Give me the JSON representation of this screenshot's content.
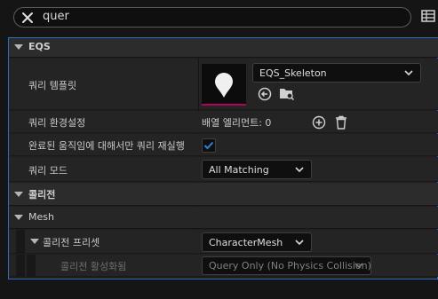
{
  "search": {
    "value": "quer"
  },
  "sections": {
    "eqs": "EQS",
    "collision": "콜리전",
    "mesh": "Mesh"
  },
  "rows": {
    "query_template": {
      "label": "쿼리 템플릿",
      "value": "EQS_Skeleton"
    },
    "query_config": {
      "label": "쿼리 환경설정",
      "value": "배열 엘리먼트: 0"
    },
    "rerun_on_move": {
      "label": "완료된 움직임에 대해서만 쿼리 재실행",
      "checked": true
    },
    "query_mode": {
      "label": "쿼리 모드",
      "value": "All Matching"
    },
    "collision_preset": {
      "label": "콜리전 프리셋",
      "value": "CharacterMesh"
    },
    "collision_enabled": {
      "label": "콜리전 활성화됨",
      "value": "Query Only (No Physics Collision)"
    }
  },
  "colors": {
    "accent_blue": "#2a6fbf",
    "check_blue": "#2f7fdc",
    "thumb_underline": "#b8005a"
  },
  "icons": [
    "close-icon",
    "grid-icon",
    "pin-icon",
    "browse-arrow-icon",
    "folder-search-icon",
    "add-icon",
    "trash-icon",
    "chevron-down-icon",
    "checkmark-icon"
  ]
}
